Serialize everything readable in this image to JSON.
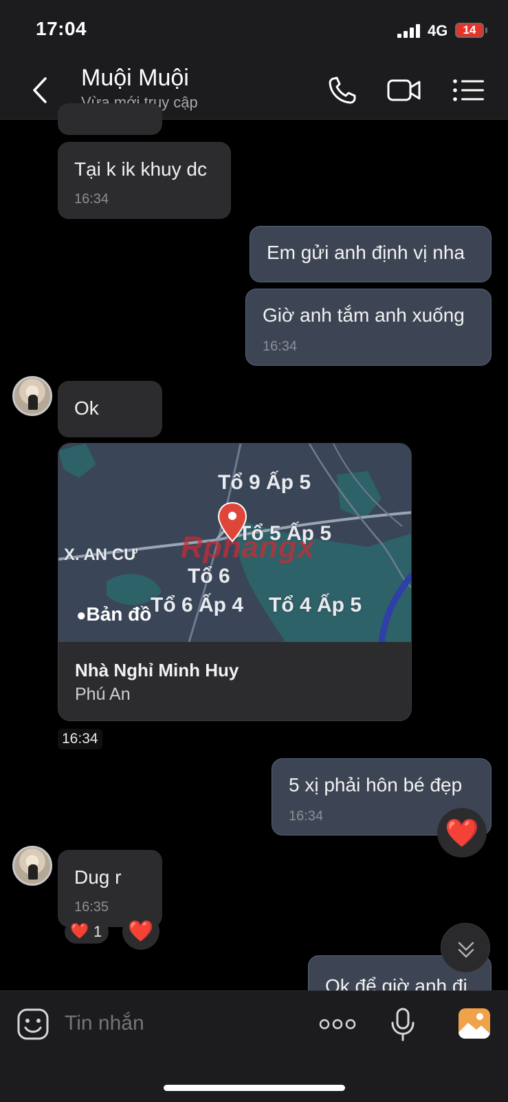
{
  "status_bar": {
    "time": "17:04",
    "network": "4G",
    "battery": "14"
  },
  "header": {
    "name": "Muội Muội",
    "status": "Vừa mới truy cập"
  },
  "messages": [
    {
      "id": "m1",
      "side": "in",
      "text": "Tại k ik khuy dc",
      "time": "16:34"
    },
    {
      "id": "m2",
      "side": "out",
      "text": "Em gửi anh định vị nha"
    },
    {
      "id": "m3",
      "side": "out",
      "text": "Giờ anh tắm anh xuống",
      "time": "16:34"
    },
    {
      "id": "m4",
      "side": "in",
      "text": "Ok"
    },
    {
      "id": "m6",
      "side": "out",
      "text": "5 xị phải hôn bé đẹp",
      "time": "16:34",
      "reaction": "❤️"
    },
    {
      "id": "m7",
      "side": "in",
      "text": "Dug r",
      "time": "16:35",
      "reaction_summary": {
        "emoji": "❤️",
        "count": "1"
      },
      "reaction": "❤️"
    },
    {
      "id": "m8",
      "side": "out",
      "text": "Ok để giờ anh đi"
    }
  ],
  "location_card": {
    "map_labels": [
      "Tổ 9 Ấp 5",
      "Tổ 5 Ấp 5",
      "X. AN CƯ",
      "Tổ 6",
      "Tổ 6 Ấp 4",
      "Tổ 4 Ấp 5"
    ],
    "maps_brand": "Bản đồ",
    "watermark": "Rphangx",
    "place_name": "Nhà Nghỉ Minh Huy",
    "place_area": "Phú An",
    "time": "16:34"
  },
  "input": {
    "placeholder": "Tin nhắn"
  },
  "colors": {
    "incoming_bubble": "#2c2c2e",
    "outgoing_bubble": "#3d4554",
    "map_water": "#2c6268",
    "pin": "#e0453a"
  }
}
